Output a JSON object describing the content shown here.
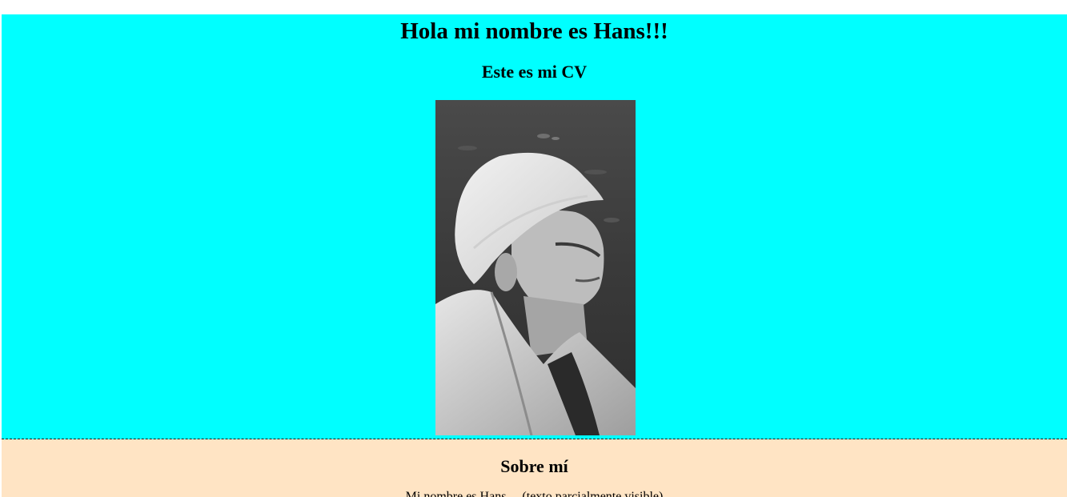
{
  "header": {
    "title": "Hola mi nombre es Hans!!!",
    "subtitle": "Este es mi CV"
  },
  "photo": {
    "alt": "Foto de perfil en blanco y negro de un hombre con sombrero blanco"
  },
  "about": {
    "title": "Sobre mí",
    "text": "Mi nombre es Hans ... (texto parcialmente visible)"
  },
  "colors": {
    "header_background": "#00ffff",
    "about_background": "#ffe4c4"
  }
}
